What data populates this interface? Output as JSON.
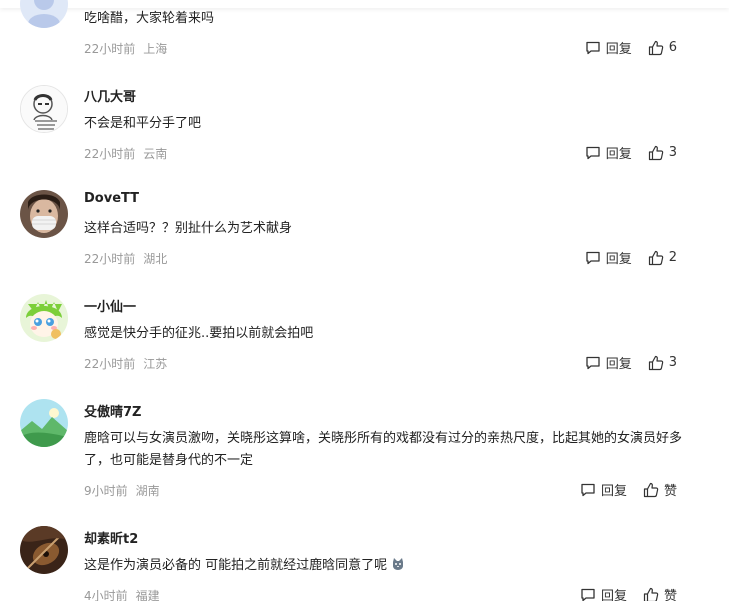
{
  "comments": [
    {
      "avatar": "cartoon-avatar-blue",
      "username": "",
      "text": "吃啥醋，大家轮着来吗",
      "time": "22小时前",
      "location": "上海",
      "reply_label": "回复",
      "like_label": "6"
    },
    {
      "avatar": "sketch-portrait-avatar",
      "username": "八几大哥",
      "text": "不会是和平分手了吧",
      "time": "22小时前",
      "location": "云南",
      "reply_label": "回复",
      "like_label": "3"
    },
    {
      "avatar": "masked-face-avatar",
      "username": "DoveTT",
      "text": "这样合适吗？？别扯什么为艺术献身",
      "time": "22小时前",
      "location": "湖北",
      "reply_label": "回复",
      "like_label": "2"
    },
    {
      "avatar": "cartoon-green-hair-avatar",
      "username": "一小仙一",
      "text": "感觉是快分手的征兆..要拍以前就会拍吧",
      "time": "22小时前",
      "location": "江苏",
      "reply_label": "回复",
      "like_label": "3"
    },
    {
      "avatar": "landscape-avatar",
      "username": "殳傲晴7Z",
      "text": "鹿晗可以与女演员激吻，关晓彤这算啥，关晓彤所有的戏都没有过分的亲热尺度，比起其她的女演员好多了，也可能是替身代的不一定",
      "time": "9小时前",
      "location": "湖南",
      "reply_label": "回复",
      "like_label": "赞"
    },
    {
      "avatar": "guitar-photo-avatar",
      "username": "却素昕t2",
      "text": "这是作为演员必备的 可能拍之前就经过鹿晗同意了呢",
      "time": "4小时前",
      "location": "福建",
      "reply_label": "回复",
      "like_label": "赞"
    }
  ],
  "icons": {
    "reply": "reply-bubble-icon",
    "like": "thumbs-up-icon",
    "emoji": "cat-emoji-icon"
  },
  "colors": {
    "meta_text": "#999999",
    "body_text": "#222222"
  }
}
